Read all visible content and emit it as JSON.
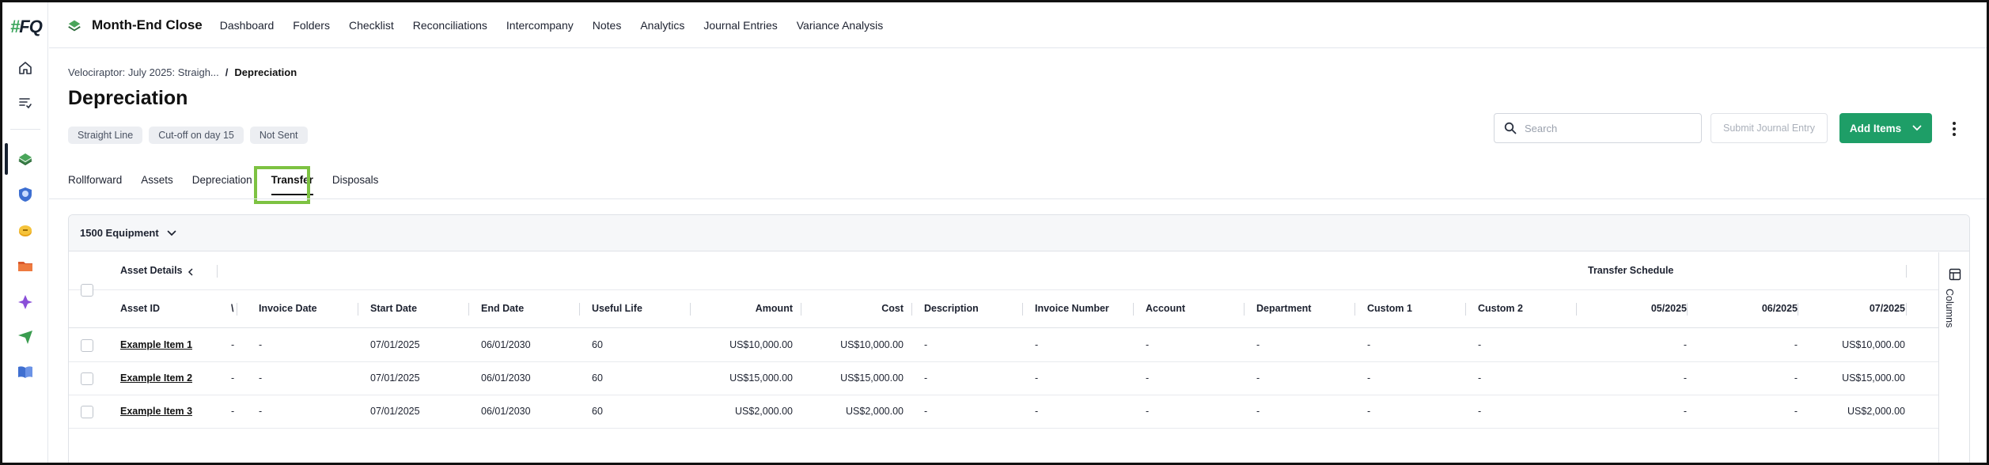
{
  "rail": {
    "logo_hash": "#",
    "logo_text": "FQ",
    "items": [
      {
        "name": "home-icon"
      },
      {
        "name": "tasks-icon"
      },
      {
        "name": "month-end-close-app-icon"
      },
      {
        "name": "shield-app-icon"
      },
      {
        "name": "coins-app-icon"
      },
      {
        "name": "folder-app-icon"
      },
      {
        "name": "gem-app-icon"
      },
      {
        "name": "send-app-icon"
      },
      {
        "name": "book-app-icon"
      }
    ]
  },
  "topnav": {
    "brand": "Month-End Close",
    "links": [
      "Dashboard",
      "Folders",
      "Checklist",
      "Reconciliations",
      "Intercompany",
      "Notes",
      "Analytics",
      "Journal Entries",
      "Variance Analysis"
    ]
  },
  "breadcrumb": {
    "parent": "Velociraptor: July 2025: Straigh...",
    "separator": "/",
    "current": "Depreciation"
  },
  "page_title": "Depreciation",
  "tags": [
    "Straight Line",
    "Cut-off on day 15",
    "Not Sent"
  ],
  "actions": {
    "search_placeholder": "Search",
    "submit_label": "Submit Journal Entry",
    "add_label": "Add Items"
  },
  "tabs": [
    "Rollforward",
    "Assets",
    "Depreciation",
    "Transfer",
    "Disposals"
  ],
  "active_tab": "Transfer",
  "card": {
    "account_selector": "1500 Equipment"
  },
  "table": {
    "group_asset_details": "Asset Details",
    "group_transfer_schedule": "Transfer Schedule",
    "truncated_header": "\\",
    "headers": {
      "asset_id": "Asset ID",
      "invoice_date": "Invoice Date",
      "start_date": "Start Date",
      "end_date": "End Date",
      "useful_life": "Useful Life",
      "amount": "Amount",
      "cost": "Cost",
      "description": "Description",
      "invoice_number": "Invoice Number",
      "account": "Account",
      "department": "Department",
      "custom1": "Custom 1",
      "custom2": "Custom 2",
      "m05": "05/2025",
      "m06": "06/2025",
      "m07": "07/2025"
    },
    "rows": [
      {
        "asset_id": "Example Item 1",
        "col_trunc": "-",
        "invoice_date": "-",
        "start_date": "07/01/2025",
        "end_date": "06/01/2030",
        "useful_life": "60",
        "amount": "US$10,000.00",
        "cost": "US$10,000.00",
        "description": "-",
        "invoice_number": "-",
        "account": "-",
        "department": "-",
        "custom1": "-",
        "custom2": "-",
        "m05": "-",
        "m06": "-",
        "m07": "US$10,000.00"
      },
      {
        "asset_id": "Example Item 2",
        "col_trunc": "-",
        "invoice_date": "-",
        "start_date": "07/01/2025",
        "end_date": "06/01/2030",
        "useful_life": "60",
        "amount": "US$15,000.00",
        "cost": "US$15,000.00",
        "description": "-",
        "invoice_number": "-",
        "account": "-",
        "department": "-",
        "custom1": "-",
        "custom2": "-",
        "m05": "-",
        "m06": "-",
        "m07": "US$15,000.00"
      },
      {
        "asset_id": "Example Item 3",
        "col_trunc": "-",
        "invoice_date": "-",
        "start_date": "07/01/2025",
        "end_date": "06/01/2030",
        "useful_life": "60",
        "amount": "US$2,000.00",
        "cost": "US$2,000.00",
        "description": "-",
        "invoice_number": "-",
        "account": "-",
        "department": "-",
        "custom1": "-",
        "custom2": "-",
        "m05": "-",
        "m06": "-",
        "m07": "US$2,000.00"
      }
    ]
  },
  "columns_panel_label": "Columns",
  "colors": {
    "accent_green": "#1e9e67",
    "highlight_green": "#7dc242"
  }
}
